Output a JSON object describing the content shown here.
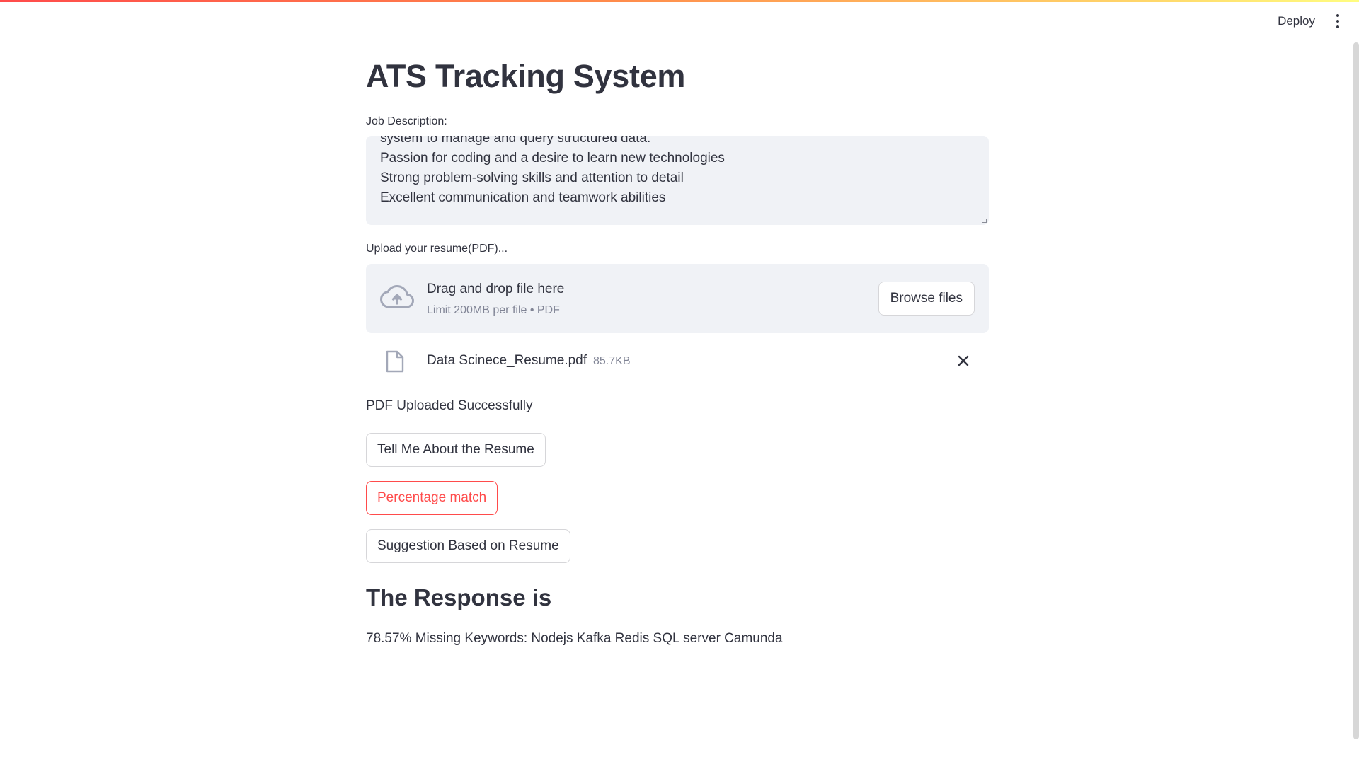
{
  "toolbar": {
    "deploy_label": "Deploy",
    "menu_icon": "kebab-menu-icon"
  },
  "page": {
    "title": "ATS Tracking System"
  },
  "job_description": {
    "label": "Job Description:",
    "visible_lines": [
      "system to manage and query structured data.",
      "Passion for coding and a desire to learn new technologies",
      "Strong problem-solving skills and attention to detail",
      "Excellent communication and teamwork abilities"
    ]
  },
  "uploader": {
    "label": "Upload your resume(PDF)...",
    "drop_title": "Drag and drop file here",
    "drop_subtitle": "Limit 200MB per file • PDF",
    "browse_label": "Browse files",
    "upload_icon": "cloud-upload-icon"
  },
  "uploaded_file": {
    "name": "Data Scinece_Resume.pdf",
    "size": "85.7KB",
    "file_icon": "file-icon",
    "remove_icon": "close-icon"
  },
  "status": {
    "message": "PDF Uploaded Successfully"
  },
  "actions": {
    "tell_me": "Tell Me About the Resume",
    "percentage_match": "Percentage match",
    "suggestion": "Suggestion Based on Resume"
  },
  "response": {
    "heading": "The Response is",
    "text": "78.57% Missing Keywords: Nodejs Kafka Redis SQL server Camunda"
  },
  "colors": {
    "accent": "#ff4b4b",
    "text": "#31333f",
    "muted": "#808495",
    "panel": "#f0f2f6"
  }
}
